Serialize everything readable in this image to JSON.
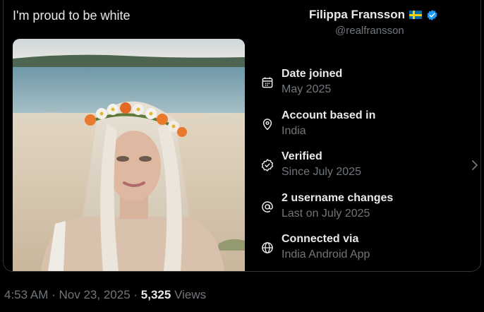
{
  "tweet": {
    "text": "I'm proud to be white"
  },
  "profile": {
    "name": "Filippa Fransson",
    "handle": "@realfransson",
    "flag_icon": "sweden-flag-icon",
    "verified_icon": "verified-badge-icon",
    "verified_color": "#1d9bf0"
  },
  "about": [
    {
      "icon": "calendar-icon",
      "title": "Date joined",
      "value": "May 2025"
    },
    {
      "icon": "location-pin-icon",
      "title": "Account based in",
      "value": "India"
    },
    {
      "icon": "verified-check-icon",
      "title": "Verified",
      "value": "Since July 2025"
    },
    {
      "icon": "at-sign-icon",
      "title": "2 username changes",
      "value": "Last on July 2025"
    },
    {
      "icon": "globe-icon",
      "title": "Connected via",
      "value": "India Android App"
    }
  ],
  "meta": {
    "time": "4:53 AM",
    "date": "Nov 23, 2025",
    "separator": "·",
    "views_count": "5,325",
    "views_label": "Views"
  }
}
